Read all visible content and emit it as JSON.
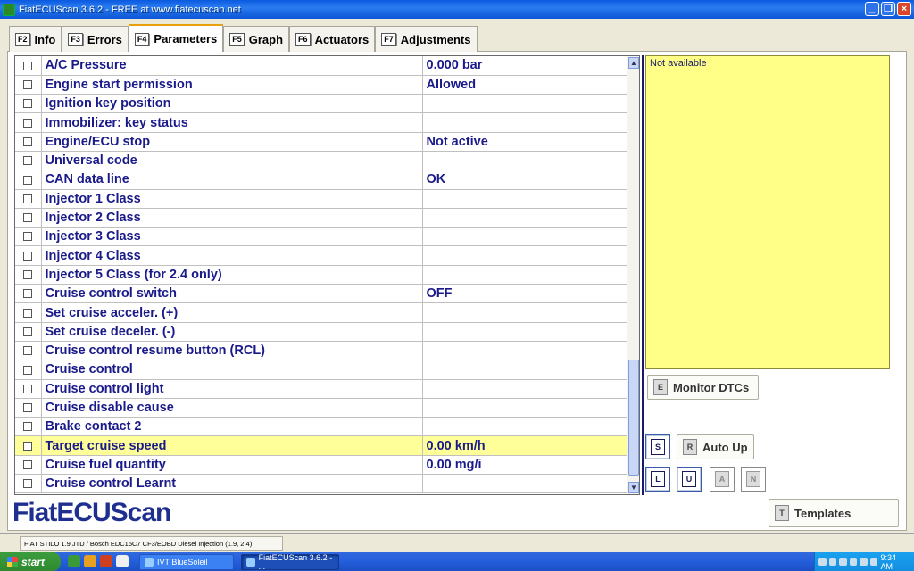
{
  "window": {
    "title": "FiatECUScan 3.6.2 - FREE at www.fiatecuscan.net"
  },
  "tabs": [
    {
      "key": "F2",
      "label": "Info"
    },
    {
      "key": "F3",
      "label": "Errors"
    },
    {
      "key": "F4",
      "label": "Parameters"
    },
    {
      "key": "F5",
      "label": "Graph"
    },
    {
      "key": "F6",
      "label": "Actuators"
    },
    {
      "key": "F7",
      "label": "Adjustments"
    }
  ],
  "params": [
    {
      "name": "A/C Pressure",
      "value": "0.000 bar"
    },
    {
      "name": "Engine start permission",
      "value": "Allowed"
    },
    {
      "name": "Ignition key position",
      "value": ""
    },
    {
      "name": "Immobilizer: key status",
      "value": ""
    },
    {
      "name": "Engine/ECU stop",
      "value": "Not active"
    },
    {
      "name": "Universal code",
      "value": ""
    },
    {
      "name": "CAN data line",
      "value": "OK"
    },
    {
      "name": "Injector 1 Class",
      "value": ""
    },
    {
      "name": "Injector 2 Class",
      "value": ""
    },
    {
      "name": "Injector 3 Class",
      "value": ""
    },
    {
      "name": "Injector 4 Class",
      "value": ""
    },
    {
      "name": "Injector 5 Class (for 2.4 only)",
      "value": ""
    },
    {
      "name": "Cruise control switch",
      "value": "OFF"
    },
    {
      "name": "Set cruise acceler. (+)",
      "value": ""
    },
    {
      "name": "Set cruise deceler. (-)",
      "value": ""
    },
    {
      "name": "Cruise control resume button (RCL)",
      "value": ""
    },
    {
      "name": "Cruise control",
      "value": ""
    },
    {
      "name": "Cruise control light",
      "value": ""
    },
    {
      "name": "Cruise disable cause",
      "value": ""
    },
    {
      "name": "Brake contact 2",
      "value": ""
    },
    {
      "name": "Target cruise speed",
      "value": "0.00 km/h",
      "highlighted": true
    },
    {
      "name": "Cruise fuel quantity",
      "value": "0.00 mg/i"
    },
    {
      "name": "Cruise control Learnt",
      "value": ""
    }
  ],
  "info": {
    "text": "Not available"
  },
  "buttons": {
    "monitor_key": "E",
    "monitor_label": "Monitor DTCs",
    "s_key": "S",
    "autoup_key": "R",
    "autoup_label": "Auto Up",
    "l_key": "L",
    "u_key": "U",
    "a_key": "A",
    "n_key": "N",
    "templates_key": "T",
    "templates_label": "Templates"
  },
  "logo": "FiatECUScan",
  "status": "FIAT STILO 1.9 JTD / Bosch EDC15C7 CF3/EOBD Diesel Injection (1.9, 2.4)",
  "taskbar": {
    "start": "start",
    "tasks": [
      "IVT BlueSoleil",
      "FiatECUScan 3.6.2 - ..."
    ],
    "clock": "9:34 AM"
  }
}
